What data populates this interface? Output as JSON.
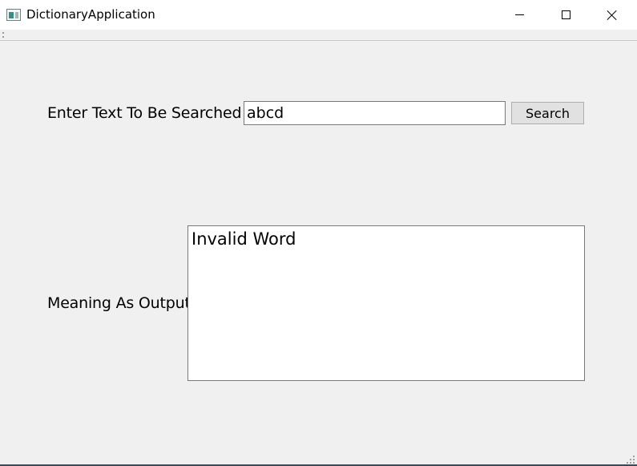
{
  "window": {
    "title": "DictionaryApplication",
    "icon": "app-window-icon",
    "controls": {
      "minimize_icon": "minimize-icon",
      "maximize_icon": "maximize-icon",
      "close_icon": "close-icon"
    }
  },
  "search": {
    "label": "Enter Text To Be Searched",
    "input_value": "abcd",
    "button_label": "Search"
  },
  "output": {
    "label": "Meaning As Output",
    "text": "Invalid Word"
  }
}
